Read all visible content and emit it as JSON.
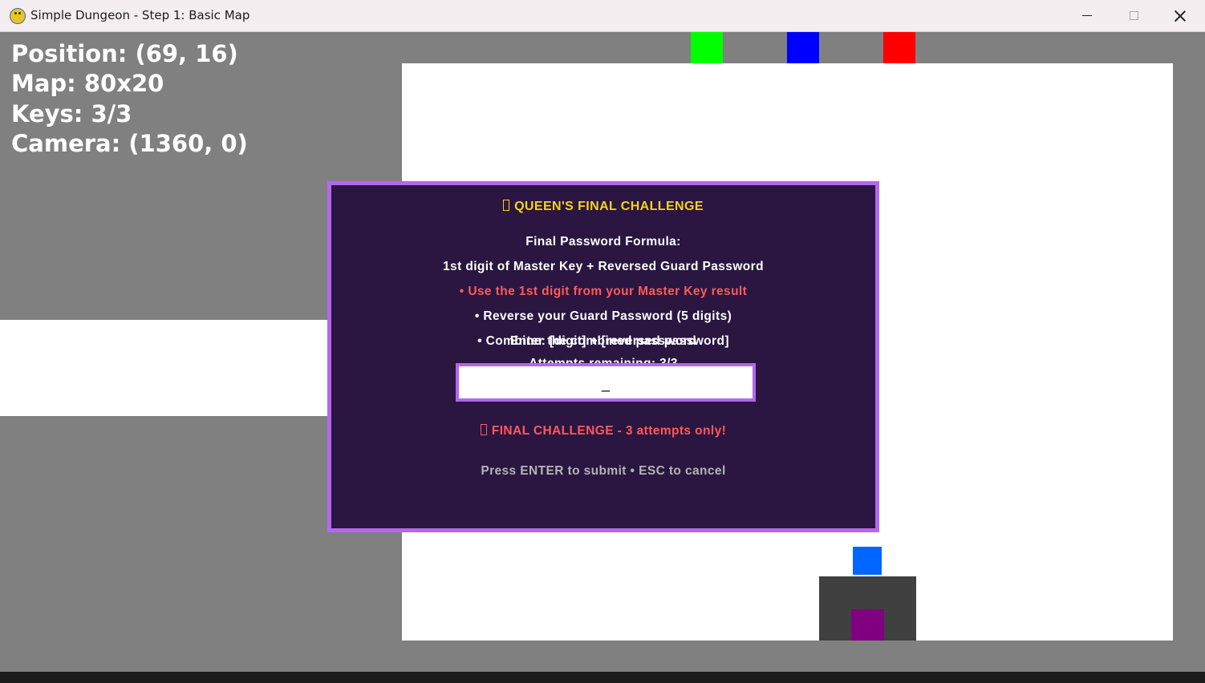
{
  "window": {
    "title": "Simple Dungeon - Step 1: Basic Map",
    "icon": "python-snake-icon",
    "controls": [
      "minimize",
      "maximize",
      "close"
    ]
  },
  "hud": {
    "position": "Position: (69, 16)",
    "map": "Map: 80x20",
    "keys": "Keys: 3/3",
    "camera": "Camera: (1360, 0)"
  },
  "colors": {
    "background": "#808080",
    "floor": "#ffffff",
    "key_green": "#00ff00",
    "key_blue": "#0000ff",
    "key_red": "#ff0000",
    "player": "#0066ff",
    "throne": "#404040",
    "queen": "#800080",
    "modal_bg": "#2a1640",
    "modal_border": "#b466f0",
    "title_yellow": "#f5d418",
    "warning_red": "#ff5a5a",
    "hint_gray": "#b4b4b4"
  },
  "modal": {
    "title_icon": "crown-icon",
    "title": "QUEEN'S FINAL CHALLENGE",
    "heading": "Final Password Formula:",
    "formula": "1st digit of Master Key + Reversed Guard Password",
    "bullet_1": "• Use the 1st digit from your Master Key result",
    "bullet_2": "• Reverse your Guard Password (5 digits)",
    "bullet_3": "• Combine: [digit] + [reversed password]",
    "overlay_text": "Enter the combined password",
    "attempts": "Attempts remaining: 3/3",
    "input_value": "_",
    "warning_icon": "warning-icon",
    "warning": "FINAL CHALLENGE - 3 attempts only!",
    "hint": "Press ENTER to submit • ESC to cancel"
  }
}
